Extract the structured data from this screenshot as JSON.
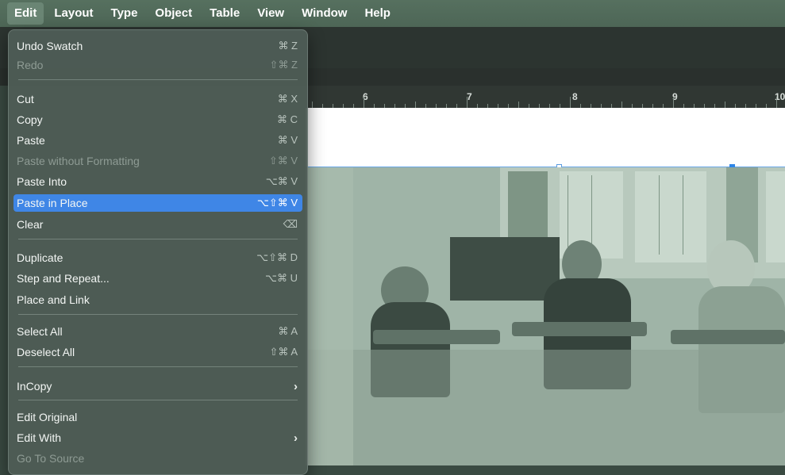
{
  "menubar": {
    "items": [
      "Edit",
      "Layout",
      "Type",
      "Object",
      "Table",
      "View",
      "Window",
      "Help"
    ]
  },
  "ruler": {
    "labels": [
      "6",
      "7",
      "8",
      "9",
      "10"
    ]
  },
  "edit_menu": {
    "items": [
      {
        "label": "Undo Swatch",
        "shortcut": "⌘ Z",
        "enabled": true
      },
      {
        "label": "Redo",
        "shortcut": "⇧⌘ Z",
        "enabled": false
      },
      {
        "label": "Cut",
        "shortcut": "⌘ X",
        "enabled": true
      },
      {
        "label": "Copy",
        "shortcut": "⌘ C",
        "enabled": true
      },
      {
        "label": "Paste",
        "shortcut": "⌘ V",
        "enabled": true
      },
      {
        "label": "Paste without Formatting",
        "shortcut": "⇧⌘ V",
        "enabled": false
      },
      {
        "label": "Paste Into",
        "shortcut": "⌥⌘ V",
        "enabled": true
      },
      {
        "label": "Paste in Place",
        "shortcut": "⌥⇧⌘ V",
        "enabled": true,
        "highlighted": true
      },
      {
        "label": "Clear",
        "shortcut": "⌫",
        "enabled": true
      },
      {
        "label": "Duplicate",
        "shortcut": "⌥⇧⌘ D",
        "enabled": true
      },
      {
        "label": "Step and Repeat...",
        "shortcut": "⌥⌘ U",
        "enabled": true
      },
      {
        "label": "Place and Link",
        "shortcut": "",
        "enabled": true
      },
      {
        "label": "Select All",
        "shortcut": "⌘ A",
        "enabled": true
      },
      {
        "label": "Deselect All",
        "shortcut": "⇧⌘ A",
        "enabled": true
      },
      {
        "label": "InCopy",
        "shortcut": "›",
        "enabled": true,
        "submenu": true
      },
      {
        "label": "Edit Original",
        "shortcut": "",
        "enabled": true
      },
      {
        "label": "Edit With",
        "shortcut": "›",
        "enabled": true,
        "submenu": true
      },
      {
        "label": "Go To Source",
        "shortcut": "",
        "enabled": false
      }
    ]
  },
  "colors": {
    "menubar": "#4d6656",
    "menu_bg": "#4e5c55",
    "highlight": "#3f86e6",
    "photo_tint": "#9fb4a7"
  }
}
